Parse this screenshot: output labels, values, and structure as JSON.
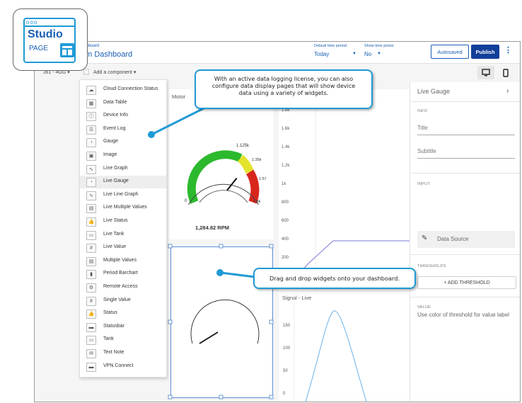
{
  "logo": {
    "word": "Studio",
    "sub": "PAGE"
  },
  "header": {
    "breadcrumb": "ashboard",
    "title": "em Dashboard",
    "time_period_label": "Default time period",
    "time_period_value": "Today",
    "time_picker_label": "Show time picker",
    "time_picker_value": "No",
    "autosaved": "Autosaved",
    "publish": "Publish",
    "kebab": "⋮"
  },
  "toolbar": {
    "version": "J61 - 4GG ▾",
    "add_component": "Add a component ▾"
  },
  "menu": {
    "items": [
      {
        "label": "Cloud Connection Status",
        "icon": "cloud-icon"
      },
      {
        "label": "Data Table",
        "icon": "table-icon"
      },
      {
        "label": "Device Info",
        "icon": "info-icon"
      },
      {
        "label": "Event Log",
        "icon": "log-icon"
      },
      {
        "label": "Gauge",
        "icon": "gauge-icon"
      },
      {
        "label": "Image",
        "icon": "image-icon"
      },
      {
        "label": "Line Graph",
        "icon": "line-graph-icon"
      },
      {
        "label": "Live Gauge",
        "icon": "live-gauge-icon"
      },
      {
        "label": "Live Line Graph",
        "icon": "live-line-graph-icon"
      },
      {
        "label": "Live Multiple Values",
        "icon": "live-multiple-values-icon"
      },
      {
        "label": "Live Status",
        "icon": "live-status-icon"
      },
      {
        "label": "Live Tank",
        "icon": "live-tank-icon"
      },
      {
        "label": "Live Value",
        "icon": "live-value-icon"
      },
      {
        "label": "Multiple Values",
        "icon": "multiple-values-icon"
      },
      {
        "label": "Period Barchart",
        "icon": "barchart-icon"
      },
      {
        "label": "Remote Access",
        "icon": "remote-access-icon"
      },
      {
        "label": "Single Value",
        "icon": "single-value-icon"
      },
      {
        "label": "Status",
        "icon": "status-icon"
      },
      {
        "label": "Statusbar",
        "icon": "statusbar-icon"
      },
      {
        "label": "Tank",
        "icon": "tank-icon"
      },
      {
        "label": "Text Note",
        "icon": "text-note-icon"
      },
      {
        "label": "VPN Connect",
        "icon": "vpn-icon"
      }
    ]
  },
  "gauge_card": {
    "title": "Motor",
    "reading": "1,284.82 RPM",
    "labels": {
      "min": "0",
      "l1": "1.125k",
      "l2": "1.35k",
      "l3": "1.57",
      "max": "1.8k"
    },
    "needle_value": 1284.82,
    "colors": {
      "green": "#2db92d",
      "yellow": "#e3e32b",
      "red": "#d9261c"
    }
  },
  "line_chart_top": {
    "y_ticks": [
      "1.8k",
      "1.6k",
      "1.4k",
      "1.2k",
      "1k",
      "800",
      "600",
      "400",
      "200"
    ],
    "line_color": "#7b7bd9"
  },
  "line_chart_bottom": {
    "title": "Signal - Live",
    "y_ticks": [
      "150",
      "100",
      "50",
      "0"
    ],
    "line_color": "#5aa9e6"
  },
  "right_panel": {
    "header": "Live Gauge",
    "info_section": "INFO",
    "title_field": "Title",
    "subtitle_field": "Subtitle",
    "input_section": "INPUT",
    "data_source": "Data Source",
    "thresholds_section": "THRESHOLDS",
    "add_threshold": "+ ADD THRESHOLD",
    "value_section": "VALUE",
    "value_text": "Use color of threshold for value label"
  },
  "callouts": {
    "top": "With an active data logging license, you can also configure data display pages that will show device data using a variety of widgets.",
    "bottom": "Drag and drop widgets onto your dashboard.",
    "color": "#1f9ad6"
  }
}
